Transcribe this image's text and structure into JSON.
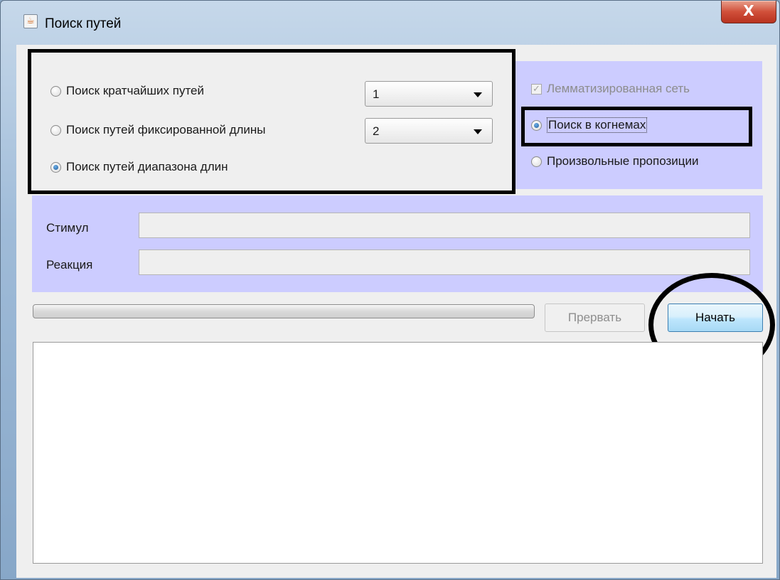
{
  "window": {
    "title": "Поиск путей",
    "close_label": "X",
    "icon": "java-coffee-cup-icon"
  },
  "search_modes": [
    {
      "label": "Поиск кратчайших путей",
      "selected": false
    },
    {
      "label": "Поиск путей фиксированной длины",
      "selected": false
    },
    {
      "label": "Поиск путей диапазона длин",
      "selected": true
    }
  ],
  "combos": {
    "shortest_count": "1",
    "fixed_length": "2"
  },
  "options": {
    "lemmatized": {
      "label": "Лемматизированная сеть",
      "checked": true,
      "enabled": false
    },
    "scope": [
      {
        "label": "Поиск в когнемах",
        "selected": true
      },
      {
        "label": "Произвольные пропозиции",
        "selected": false
      }
    ]
  },
  "fields": {
    "stimulus": {
      "label": "Стимул",
      "value": ""
    },
    "reaction": {
      "label": "Реакция",
      "value": ""
    }
  },
  "progress": {
    "value": 0
  },
  "buttons": {
    "abort_label": "Прервать",
    "start_label": "Начать"
  },
  "output_text": "",
  "colors": {
    "panel_accent": "#ccccff",
    "client_bg": "#efefef"
  }
}
